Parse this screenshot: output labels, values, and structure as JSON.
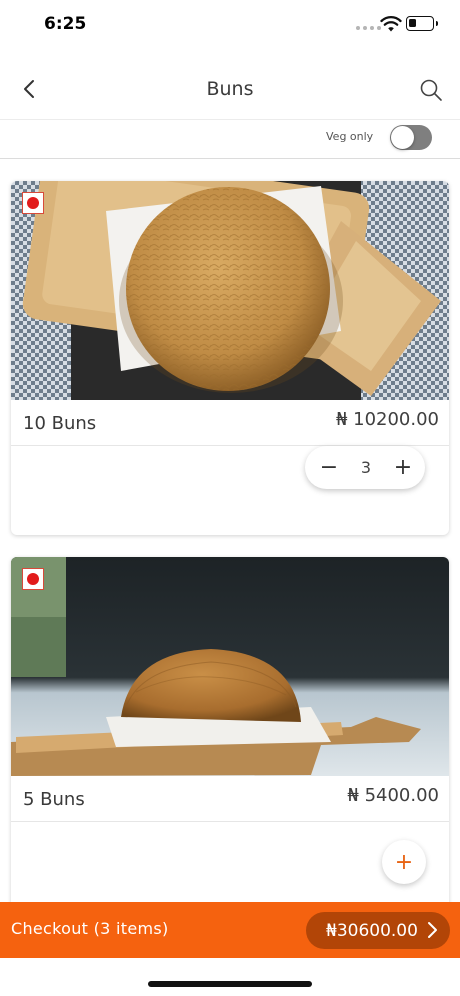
{
  "status_bar": {
    "time": "6:25"
  },
  "header": {
    "title": "Buns",
    "back_icon": "chevron-left-icon",
    "search_icon": "search-icon"
  },
  "filter": {
    "veg_only_label": "Veg only",
    "veg_only_enabled": false
  },
  "products": [
    {
      "name": "10 Buns",
      "price": "₦ 10200.00",
      "quantity": "3",
      "veg_indicator": "non-veg",
      "in_cart": true
    },
    {
      "name": "5 Buns",
      "price": "₦ 5400.00",
      "add_label": "+",
      "veg_indicator": "non-veg",
      "in_cart": false
    }
  ],
  "stepper": {
    "minus_label": "−",
    "plus_label": "+"
  },
  "checkout": {
    "label": "Checkout (3 items)",
    "total": "₦30600.00"
  },
  "colors": {
    "accent": "#f5620f",
    "accent_dark": "#b24507",
    "non_veg_dot": "#e21b1b"
  }
}
